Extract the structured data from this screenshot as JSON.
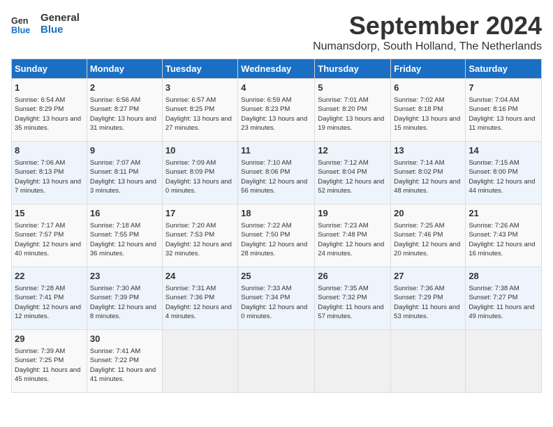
{
  "logo": {
    "line1": "General",
    "line2": "Blue"
  },
  "title": "September 2024",
  "location": "Numansdorp, South Holland, The Netherlands",
  "days_of_week": [
    "Sunday",
    "Monday",
    "Tuesday",
    "Wednesday",
    "Thursday",
    "Friday",
    "Saturday"
  ],
  "weeks": [
    [
      {
        "day": "1",
        "sunrise": "6:54 AM",
        "sunset": "8:29 PM",
        "daylight": "13 hours and 35 minutes."
      },
      {
        "day": "2",
        "sunrise": "6:56 AM",
        "sunset": "8:27 PM",
        "daylight": "13 hours and 31 minutes."
      },
      {
        "day": "3",
        "sunrise": "6:57 AM",
        "sunset": "8:25 PM",
        "daylight": "13 hours and 27 minutes."
      },
      {
        "day": "4",
        "sunrise": "6:59 AM",
        "sunset": "8:23 PM",
        "daylight": "13 hours and 23 minutes."
      },
      {
        "day": "5",
        "sunrise": "7:01 AM",
        "sunset": "8:20 PM",
        "daylight": "13 hours and 19 minutes."
      },
      {
        "day": "6",
        "sunrise": "7:02 AM",
        "sunset": "8:18 PM",
        "daylight": "13 hours and 15 minutes."
      },
      {
        "day": "7",
        "sunrise": "7:04 AM",
        "sunset": "8:16 PM",
        "daylight": "13 hours and 11 minutes."
      }
    ],
    [
      {
        "day": "8",
        "sunrise": "7:06 AM",
        "sunset": "8:13 PM",
        "daylight": "13 hours and 7 minutes."
      },
      {
        "day": "9",
        "sunrise": "7:07 AM",
        "sunset": "8:11 PM",
        "daylight": "13 hours and 3 minutes."
      },
      {
        "day": "10",
        "sunrise": "7:09 AM",
        "sunset": "8:09 PM",
        "daylight": "13 hours and 0 minutes."
      },
      {
        "day": "11",
        "sunrise": "7:10 AM",
        "sunset": "8:06 PM",
        "daylight": "12 hours and 56 minutes."
      },
      {
        "day": "12",
        "sunrise": "7:12 AM",
        "sunset": "8:04 PM",
        "daylight": "12 hours and 52 minutes."
      },
      {
        "day": "13",
        "sunrise": "7:14 AM",
        "sunset": "8:02 PM",
        "daylight": "12 hours and 48 minutes."
      },
      {
        "day": "14",
        "sunrise": "7:15 AM",
        "sunset": "8:00 PM",
        "daylight": "12 hours and 44 minutes."
      }
    ],
    [
      {
        "day": "15",
        "sunrise": "7:17 AM",
        "sunset": "7:57 PM",
        "daylight": "12 hours and 40 minutes."
      },
      {
        "day": "16",
        "sunrise": "7:18 AM",
        "sunset": "7:55 PM",
        "daylight": "12 hours and 36 minutes."
      },
      {
        "day": "17",
        "sunrise": "7:20 AM",
        "sunset": "7:53 PM",
        "daylight": "12 hours and 32 minutes."
      },
      {
        "day": "18",
        "sunrise": "7:22 AM",
        "sunset": "7:50 PM",
        "daylight": "12 hours and 28 minutes."
      },
      {
        "day": "19",
        "sunrise": "7:23 AM",
        "sunset": "7:48 PM",
        "daylight": "12 hours and 24 minutes."
      },
      {
        "day": "20",
        "sunrise": "7:25 AM",
        "sunset": "7:46 PM",
        "daylight": "12 hours and 20 minutes."
      },
      {
        "day": "21",
        "sunrise": "7:26 AM",
        "sunset": "7:43 PM",
        "daylight": "12 hours and 16 minutes."
      }
    ],
    [
      {
        "day": "22",
        "sunrise": "7:28 AM",
        "sunset": "7:41 PM",
        "daylight": "12 hours and 12 minutes."
      },
      {
        "day": "23",
        "sunrise": "7:30 AM",
        "sunset": "7:39 PM",
        "daylight": "12 hours and 8 minutes."
      },
      {
        "day": "24",
        "sunrise": "7:31 AM",
        "sunset": "7:36 PM",
        "daylight": "12 hours and 4 minutes."
      },
      {
        "day": "25",
        "sunrise": "7:33 AM",
        "sunset": "7:34 PM",
        "daylight": "12 hours and 0 minutes."
      },
      {
        "day": "26",
        "sunrise": "7:35 AM",
        "sunset": "7:32 PM",
        "daylight": "11 hours and 57 minutes."
      },
      {
        "day": "27",
        "sunrise": "7:36 AM",
        "sunset": "7:29 PM",
        "daylight": "11 hours and 53 minutes."
      },
      {
        "day": "28",
        "sunrise": "7:38 AM",
        "sunset": "7:27 PM",
        "daylight": "11 hours and 49 minutes."
      }
    ],
    [
      {
        "day": "29",
        "sunrise": "7:39 AM",
        "sunset": "7:25 PM",
        "daylight": "11 hours and 45 minutes."
      },
      {
        "day": "30",
        "sunrise": "7:41 AM",
        "sunset": "7:22 PM",
        "daylight": "11 hours and 41 minutes."
      },
      null,
      null,
      null,
      null,
      null
    ]
  ]
}
